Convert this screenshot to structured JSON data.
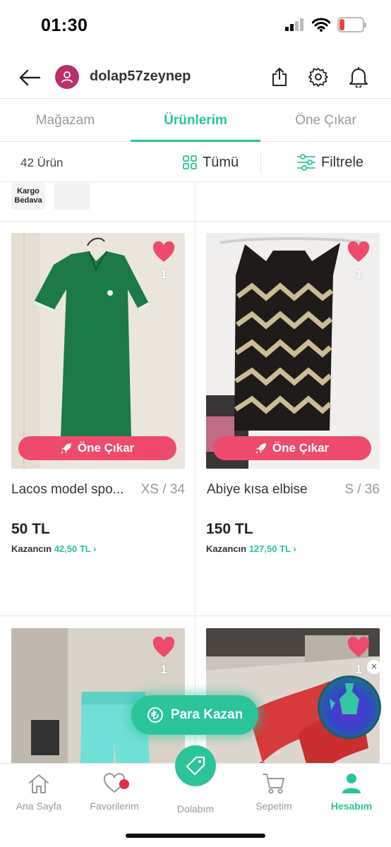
{
  "status": {
    "time": "01:30",
    "battery": "20",
    "battery_level": 0.2
  },
  "header": {
    "username": "dolap57zeynep"
  },
  "tabs": [
    {
      "label": "Mağazam",
      "active": false
    },
    {
      "label": "Ürünlerim",
      "active": true
    },
    {
      "label": "Öne Çıkar",
      "active": false
    }
  ],
  "toolbar": {
    "count": "42 Ürün",
    "all_label": "Tümü",
    "filter_label": "Filtrele"
  },
  "badges": {
    "kargo": "Kargo Bedava"
  },
  "products": [
    {
      "title": "Lacos model spo...",
      "size": "XS / 34",
      "price": "50 TL",
      "earn_label": "Kazancın",
      "earn_value": "42,50 TL",
      "likes": "1",
      "promote": "Öne Çıkar"
    },
    {
      "title": "Abiye kısa elbise",
      "size": "S / 36",
      "price": "150 TL",
      "earn_label": "Kazancın",
      "earn_value": "127,50 TL",
      "likes": "1",
      "promote": "Öne Çıkar"
    },
    {
      "likes": "1"
    },
    {
      "likes": "1"
    }
  ],
  "floating": {
    "para_kazan": "Para Kazan"
  },
  "bottom_nav": [
    {
      "label": "Ana Sayfa",
      "icon": "home-icon"
    },
    {
      "label": "Favorilerim",
      "icon": "heart-icon"
    },
    {
      "label": "Dolabım",
      "icon": "tag-icon"
    },
    {
      "label": "Sepetim",
      "icon": "cart-icon"
    },
    {
      "label": "Hesabım",
      "icon": "person-icon",
      "active": true
    }
  ],
  "colors": {
    "accent": "#2bc49a",
    "promote": "#ee4a6c",
    "heart": "#ee4a6c",
    "avatar": "#b8306c"
  }
}
